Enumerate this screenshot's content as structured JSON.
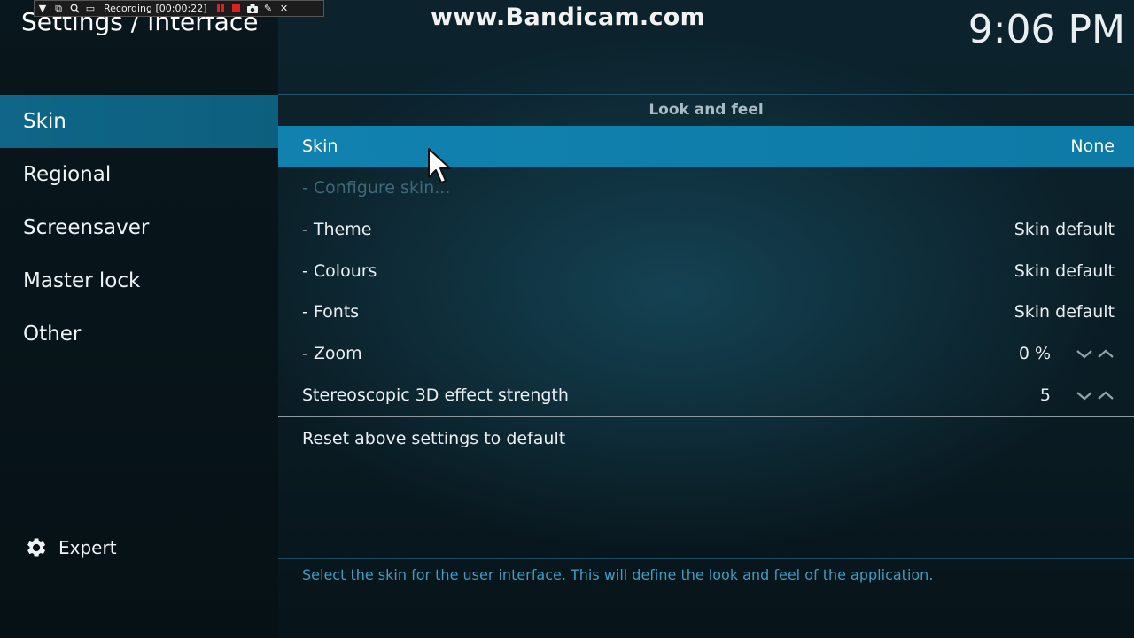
{
  "header": {
    "title": "Settings / Interface",
    "clock": "9:06 PM",
    "watermark": "www.Bandicam.com"
  },
  "recorder": {
    "status": "Recording [00:00:22]"
  },
  "sidebar": {
    "items": [
      {
        "label": "Skin",
        "active": true
      },
      {
        "label": "Regional"
      },
      {
        "label": "Screensaver"
      },
      {
        "label": "Master lock"
      },
      {
        "label": "Other"
      }
    ],
    "expert_label": "Expert"
  },
  "main": {
    "section_title": "Look and feel",
    "rows": [
      {
        "label": "Skin",
        "value": "None",
        "state": "focused"
      },
      {
        "label": "- Configure skin...",
        "value": "",
        "state": "disabled"
      },
      {
        "label": "- Theme",
        "value": "Skin default"
      },
      {
        "label": "- Colours",
        "value": "Skin default"
      },
      {
        "label": "- Fonts",
        "value": "Skin default"
      },
      {
        "label": "- Zoom",
        "value": "0 %",
        "control": "spinner"
      },
      {
        "label": "Stereoscopic 3D effect strength",
        "value": "5",
        "control": "spinner"
      }
    ],
    "reset_label": "Reset above settings to default",
    "help_text": "Select the skin for the user interface. This will define the look and feel of the application."
  },
  "colors": {
    "accent": "#1182b0",
    "sidebar_active": "#0f6688",
    "help_text": "#3f9cc4"
  }
}
